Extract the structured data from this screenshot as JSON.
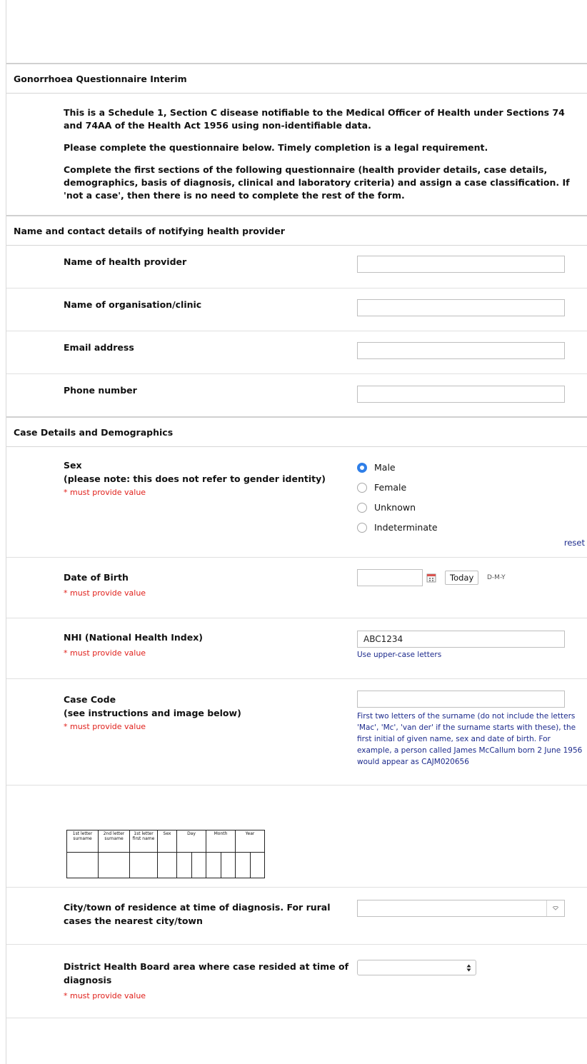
{
  "form": {
    "title": "Gonorrhoea Questionnaire Interim",
    "intro": [
      "This is a Schedule 1, Section C disease notifiable to the Medical Officer of Health under Sections 74 and 74AA of the Health Act 1956 using non-identifiable data.",
      "Please complete the questionnaire below. Timely completion is a legal requirement.",
      "Complete the first sections of the following questionnaire (health provider details, case details, demographics, basis of diagnosis, clinical and laboratory criteria) and assign a case classification. If 'not a case', then there is no need to complete the rest of the form."
    ]
  },
  "provider": {
    "header": "Name and contact details of notifying health provider",
    "name_label": "Name of health provider",
    "org_label": "Name of organisation/clinic",
    "email_label": "Email address",
    "phone_label": "Phone number"
  },
  "case": {
    "header": "Case Details and Demographics",
    "required_text": "* must provide value",
    "sex": {
      "label": "Sex",
      "note": "(please note: this does not refer to gender identity)",
      "options": [
        "Male",
        "Female",
        "Unknown",
        "Indeterminate"
      ],
      "selected": "Male",
      "reset": "reset"
    },
    "dob": {
      "label": "Date of Birth",
      "today": "Today",
      "format": "D-M-Y"
    },
    "nhi": {
      "label": "NHI (National Health Index)",
      "value": "ABC1234",
      "hint": "Use upper-case letters"
    },
    "case_code": {
      "label": "Case Code",
      "note": "(see instructions and image below)",
      "hint": "First two letters of the surname (do not include the letters 'Mac', 'Mc', 'van der' if the surname starts with these), the first initial of given name, sex and date of birth. For example, a person called James McCallum born 2 June 1956 would appear as CAJM020656"
    },
    "code_table": [
      "1st letter surname",
      "2nd letter surname",
      "1st letter first name",
      "Sex",
      "Day",
      "Month",
      "Year"
    ],
    "city": {
      "label": "City/town of residence at time of diagnosis. For rural cases the nearest city/town"
    },
    "dhb": {
      "label": "District Health Board area where case resided at time of diagnosis"
    }
  },
  "colors": {
    "accent": "#2f7fe8",
    "required": "#e0201b",
    "hint": "#1c2a8c"
  }
}
